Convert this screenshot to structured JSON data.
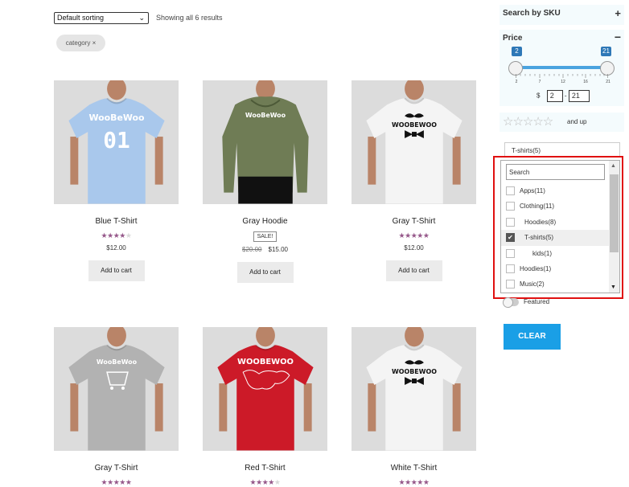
{
  "toolbar": {
    "sort_value": "Default sorting",
    "result_count": "Showing all 6 results",
    "active_filter_chip": "category ×"
  },
  "products": [
    {
      "title": "Blue T-Shirt",
      "rating": 4,
      "price": "$12.00",
      "button": "Add to cart",
      "shirt_color": "#a9c8ec",
      "print": "WooBeWoo 01"
    },
    {
      "title": "Gray Hoodie",
      "rating": null,
      "sale_badge": "SALE!",
      "old_price": "$20.00",
      "price": "$15.00",
      "button": "Add to cart",
      "shirt_color": "#6f7c55",
      "print": "WooBeWoo"
    },
    {
      "title": "Gray T-Shirt",
      "rating": 5,
      "price": "$12.00",
      "button": "Add to cart",
      "shirt_color": "#f4f4f4",
      "print": "WOOBEWOO"
    },
    {
      "title": "Gray T-Shirt",
      "rating": 5,
      "shirt_color": "#b2b2b2",
      "print": "WooBeWoo"
    },
    {
      "title": "Red T-Shirt",
      "rating": 4,
      "shirt_color": "#cc1a28",
      "print": "WOOBEWOO"
    },
    {
      "title": "White T-Shirt",
      "rating": 5,
      "shirt_color": "#f4f4f4",
      "print": "WOOBEWOO"
    }
  ],
  "sidebar": {
    "sku_title": "Search by SKU",
    "price_title": "Price",
    "price_min_badge": "2",
    "price_max_badge": "21",
    "price_ticks": [
      "2",
      "7",
      "12",
      "16",
      "21"
    ],
    "currency": "$",
    "price_min_value": "2",
    "price_max_value": "21",
    "rating_suffix": "and up",
    "category_header": "T-shirts(5)",
    "category_search_placeholder": "Search",
    "categories": [
      {
        "label": "Apps(11)",
        "checked": false,
        "indent": 0
      },
      {
        "label": "Clothing(11)",
        "checked": false,
        "indent": 0
      },
      {
        "label": "Hoodies(8)",
        "checked": false,
        "indent": 1
      },
      {
        "label": "T-shirts(5)",
        "checked": true,
        "indent": 1
      },
      {
        "label": "kids(1)",
        "checked": false,
        "indent": 2
      },
      {
        "label": "Hoodies(1)",
        "checked": false,
        "indent": 0
      },
      {
        "label": "Music(2)",
        "checked": false,
        "indent": 0
      }
    ],
    "featured_label": "Featured",
    "clear_button": "CLEAR"
  },
  "colors": {
    "star_active": "#96588a",
    "clear_button": "#1a9fe6",
    "slider_badge": "#2e78b7",
    "highlight_frame": "#e01010"
  }
}
